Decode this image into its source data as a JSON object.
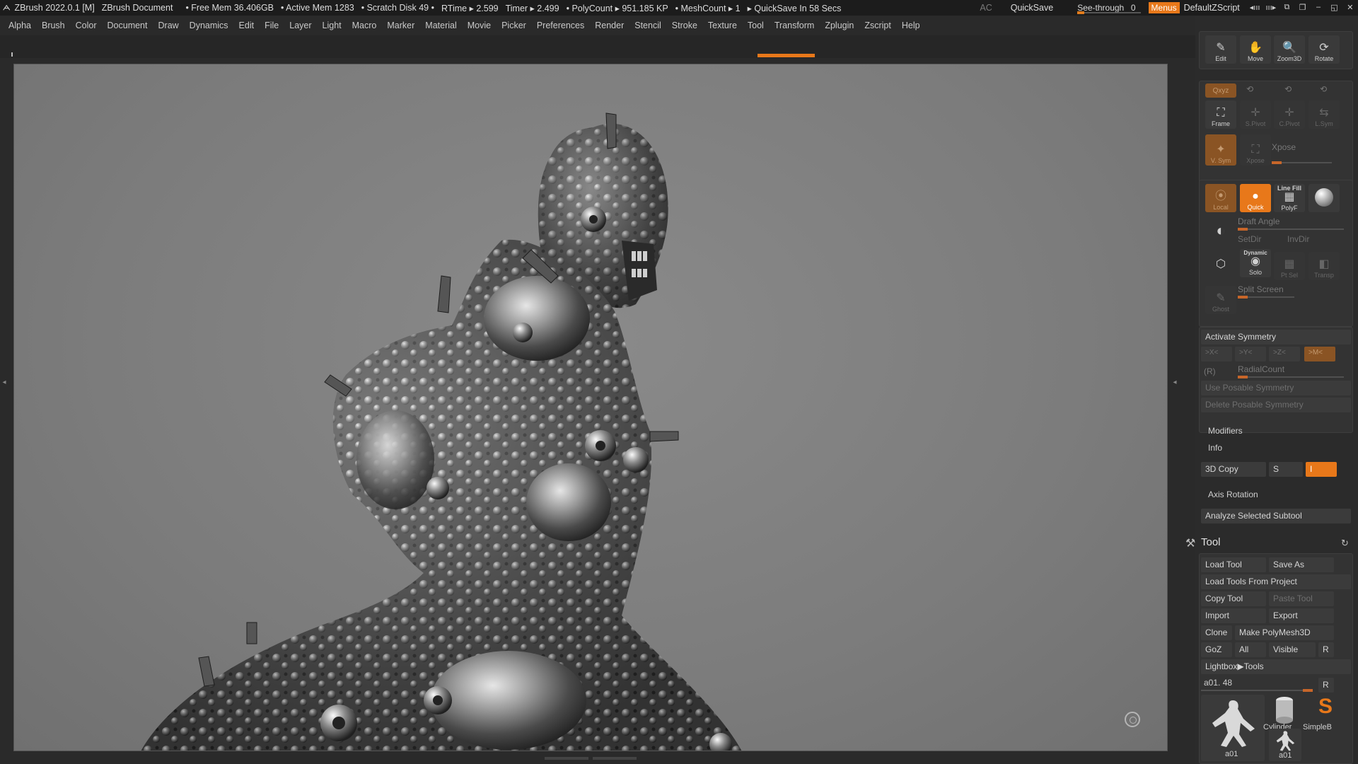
{
  "titlebar": {
    "app": "ZBrush 2022.0.1 [M]",
    "document": "ZBrush Document",
    "free_mem": "• Free Mem 36.406GB",
    "active_mem": "• Active Mem 1283",
    "scratch": "• Scratch Disk 49 •",
    "rtime": "RTime ▸ 2.599",
    "timer": "Timer ▸ 2.499",
    "polycount": "• PolyCount ▸ 951.185 KP",
    "meshcount": "• MeshCount ▸ 1",
    "quicksave_in": "▸ QuickSave In 58 Secs",
    "ac": "AC",
    "quicksave": "QuickSave",
    "see_through": "See-through",
    "see_through_value": "0",
    "menus": "Menus",
    "script": "DefaultZScript"
  },
  "menubar": [
    "Alpha",
    "Brush",
    "Color",
    "Document",
    "Draw",
    "Dynamics",
    "Edit",
    "File",
    "Layer",
    "Light",
    "Macro",
    "Marker",
    "Material",
    "Movie",
    "Picker",
    "Preferences",
    "Render",
    "Stencil",
    "Stroke",
    "Texture",
    "Tool",
    "Transform",
    "Zplugin",
    "Zscript",
    "Help"
  ],
  "nav": {
    "edit": "Edit",
    "move": "Move",
    "zoom3d": "Zoom3D",
    "rotate": "Rotate"
  },
  "transform": {
    "xyz": "Qxyz",
    "frame": "Frame",
    "spivot": "S.Pivot",
    "cpivot": "C.Pivot",
    "lsym": "L.Sym",
    "vsym": "V. Sym",
    "xpose": "Xpose",
    "xpose_label": "Xpose"
  },
  "draw": {
    "local": "Local",
    "quick": "Quick",
    "linefill": "Line Fill",
    "polyf": "PolyF",
    "draft_angle": "Draft Angle",
    "setdir": "SetDir",
    "invdir": "InvDir",
    "dynamic": "Dynamic",
    "solo": "Solo",
    "ptsel": "Pt Sel",
    "transp": "Transp",
    "ghost": "Ghost",
    "split_screen": "Split Screen"
  },
  "symmetry": {
    "activate": "Activate Symmetry",
    "x": ">X<",
    "y": ">Y<",
    "z": ">Z<",
    "m": ">M<",
    "r": "(R)",
    "radial": "RadialCount",
    "use_posable": "Use Posable Symmetry",
    "delete_posable": "Delete Posable Symmetry"
  },
  "modifiers": "Modifiers",
  "info": "Info",
  "copy3d": {
    "label": "3D Copy",
    "s": "S",
    "i": "I"
  },
  "axis_rotation": "Axis Rotation",
  "analyze": "Analyze Selected Subtool",
  "tool": {
    "title": "Tool",
    "load": "Load Tool",
    "save_as": "Save As",
    "load_project": "Load Tools From Project",
    "copy": "Copy Tool",
    "paste": "Paste Tool",
    "import": "Import",
    "export": "Export",
    "clone": "Clone",
    "make_polymesh": "Make PolyMesh3D",
    "goz": "GoZ",
    "all": "All",
    "visible": "Visible",
    "r": "R",
    "lightbox": "Lightbox▶Tools",
    "current": "a01. 48",
    "current_r": "R",
    "thumb_a01": "a01",
    "thumb_cylinder": "Cylinder",
    "thumb_simpleb": "SimpleB",
    "thumb_a01_small": "a01"
  },
  "colors": {
    "accent": "#e8781a",
    "canvas": "#7f7f7f",
    "panel": "#2b2b2b"
  }
}
